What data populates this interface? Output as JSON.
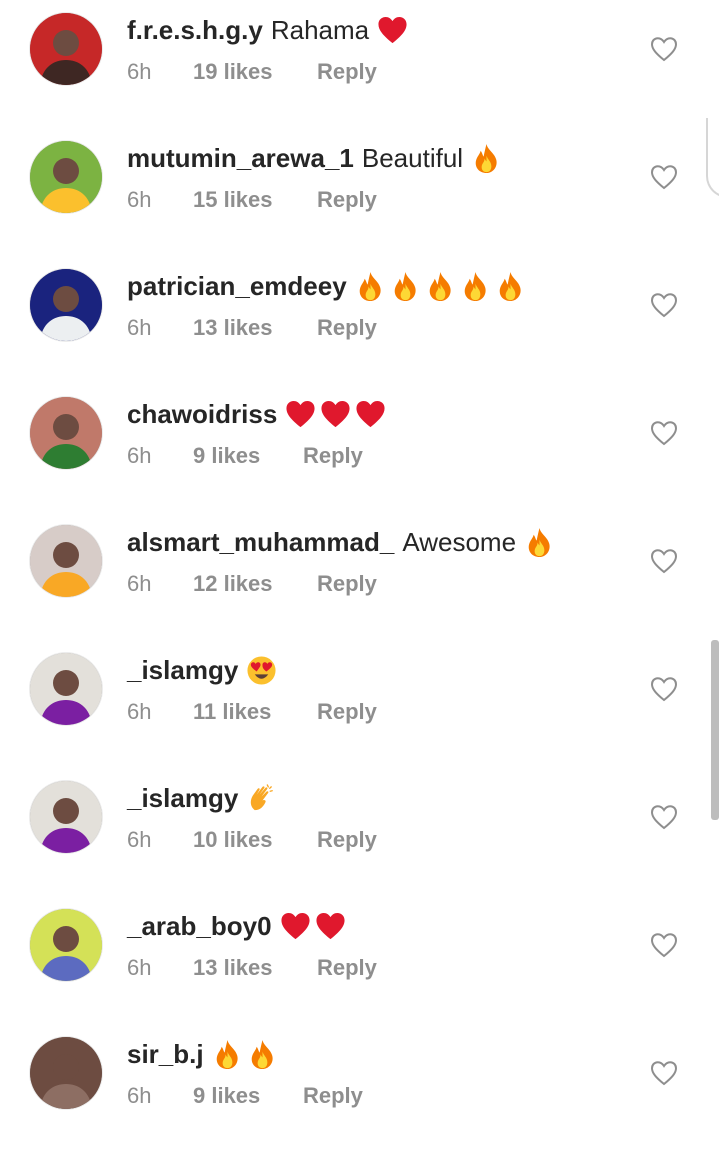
{
  "comments": [
    {
      "username": "f.r.e.s.h.g.y",
      "text": "Rahama",
      "emojis": [
        "heart"
      ],
      "time": "6h",
      "likes": "19 likes",
      "reply": "Reply",
      "avatar_bg": "#c62828",
      "avatar_fg": "#3e2723"
    },
    {
      "username": "mutumin_arewa_1",
      "text": "Beautiful",
      "emojis": [
        "fire"
      ],
      "time": "6h",
      "likes": "15 likes",
      "reply": "Reply",
      "avatar_bg": "#7cb342",
      "avatar_fg": "#fbc02d"
    },
    {
      "username": "patrician_emdeey",
      "text": "",
      "emojis": [
        "fire",
        "fire",
        "fire",
        "fire",
        "fire"
      ],
      "time": "6h",
      "likes": "13 likes",
      "reply": "Reply",
      "avatar_bg": "#1a237e",
      "avatar_fg": "#eceff1"
    },
    {
      "username": "chawoidriss",
      "text": "",
      "emojis": [
        "heart",
        "heart",
        "heart"
      ],
      "time": "6h",
      "likes": "9 likes",
      "reply": "Reply",
      "avatar_bg": "#c0796a",
      "avatar_fg": "#2e7d32"
    },
    {
      "username": "alsmart_muhammad_",
      "text": "Awesome",
      "emojis": [
        "fire"
      ],
      "time": "6h",
      "likes": "12 likes",
      "reply": "Reply",
      "avatar_bg": "#d7ccc8",
      "avatar_fg": "#f9a825"
    },
    {
      "username": "_islamgy",
      "text": "",
      "emojis": [
        "heart-eyes"
      ],
      "time": "6h",
      "likes": "11 likes",
      "reply": "Reply",
      "avatar_bg": "#e3e0da",
      "avatar_fg": "#7b1fa2"
    },
    {
      "username": "_islamgy",
      "text": "",
      "emojis": [
        "clap"
      ],
      "time": "6h",
      "likes": "10 likes",
      "reply": "Reply",
      "avatar_bg": "#e3e0da",
      "avatar_fg": "#7b1fa2"
    },
    {
      "username": "_arab_boy0",
      "text": "",
      "emojis": [
        "heart",
        "heart"
      ],
      "time": "6h",
      "likes": "13 likes",
      "reply": "Reply",
      "avatar_bg": "#d4e157",
      "avatar_fg": "#5c6bc0"
    },
    {
      "username": "sir_b.j",
      "text": "",
      "emojis": [
        "fire",
        "fire"
      ],
      "time": "6h",
      "likes": "9 likes",
      "reply": "Reply",
      "avatar_bg": "#6d4c41",
      "avatar_fg": "#8d6e63"
    }
  ],
  "colors": {
    "text": "#262626",
    "meta": "#8e8e8e",
    "heart_red": "#e0182d",
    "fire_orange": "#f57c00"
  }
}
